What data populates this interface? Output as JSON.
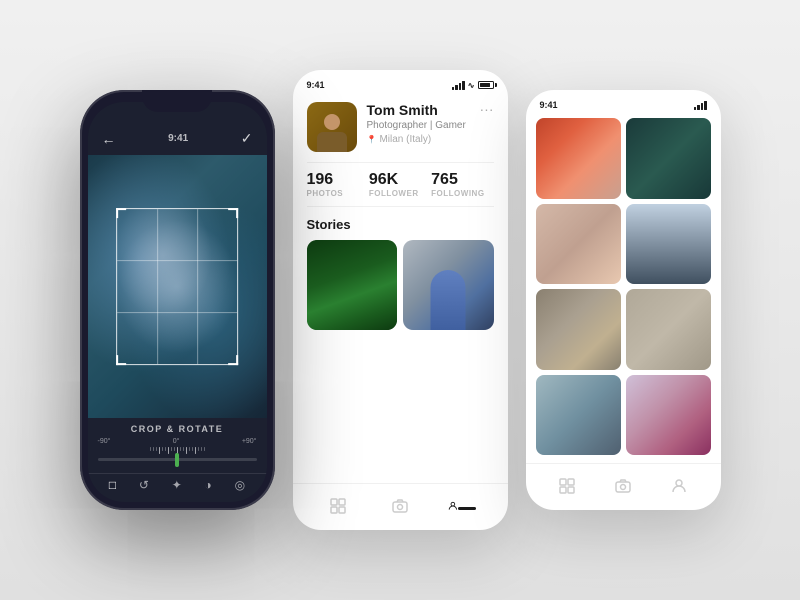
{
  "scene": {
    "background": "#e8e8e8"
  },
  "phone1": {
    "statusbar": {
      "time": "9:41",
      "label": "crop_screen"
    },
    "crop_label": "CROP & ROTATE",
    "slider_marks": {
      "left": "-90°",
      "center": "0°",
      "right": "+90°"
    },
    "icons": [
      "crop-icon",
      "sun-icon",
      "contrast-icon",
      "circle-icon"
    ]
  },
  "phone2": {
    "statusbar": {
      "time": "9:41"
    },
    "profile": {
      "name": "Tom Smith",
      "bio": "Photographer | Gamer",
      "location": "Milan (Italy)"
    },
    "stats": [
      {
        "value": "196",
        "label": "PHOTOS"
      },
      {
        "value": "96K",
        "label": "FOLLOWER"
      },
      {
        "value": "765",
        "label": "FOLLOWING"
      }
    ],
    "stories_title": "Stories",
    "nav_items": [
      "gallery",
      "instagram",
      "profile"
    ]
  },
  "phone3": {
    "statusbar": {
      "time": "9:41"
    },
    "gallery_images": [
      "red-hair",
      "dark-teal",
      "mountain",
      "tubes",
      "fence",
      "hands"
    ],
    "nav_items": [
      "gallery",
      "instagram",
      "profile"
    ]
  }
}
